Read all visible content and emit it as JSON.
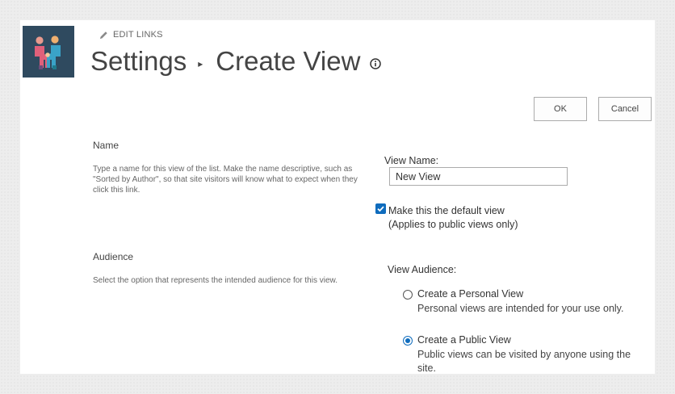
{
  "header": {
    "edit_links": "EDIT LINKS",
    "breadcrumb_parent": "Settings",
    "breadcrumb_separator": "▸",
    "page_title": "Create View"
  },
  "icons": {
    "logo": "people-handshake-logo",
    "edit": "pencil-icon",
    "info": "info-icon"
  },
  "actions": {
    "ok_label": "OK",
    "cancel_label": "Cancel"
  },
  "name_section": {
    "heading": "Name",
    "description": "Type a name for this view of the list. Make the name descriptive, such as \"Sorted by Author\", so that site visitors will know what to expect when they click this link.",
    "field_label": "View Name:",
    "field_value": "New View",
    "default_checkbox_checked": true,
    "default_checkbox_label": "Make this the default view",
    "default_checkbox_note": "(Applies to public views only)"
  },
  "audience_section": {
    "heading": "Audience",
    "description": "Select the option that represents the intended audience for this view.",
    "field_label": "View Audience:",
    "options": [
      {
        "title": "Create a Personal View",
        "description": "Personal views are intended for your use only.",
        "selected": false
      },
      {
        "title": "Create a Public View",
        "description": "Public views can be visited by anyone using the site.",
        "selected": true
      }
    ]
  },
  "colors": {
    "accent": "#0f6cbd",
    "logo_background": "#2f4a5f"
  }
}
